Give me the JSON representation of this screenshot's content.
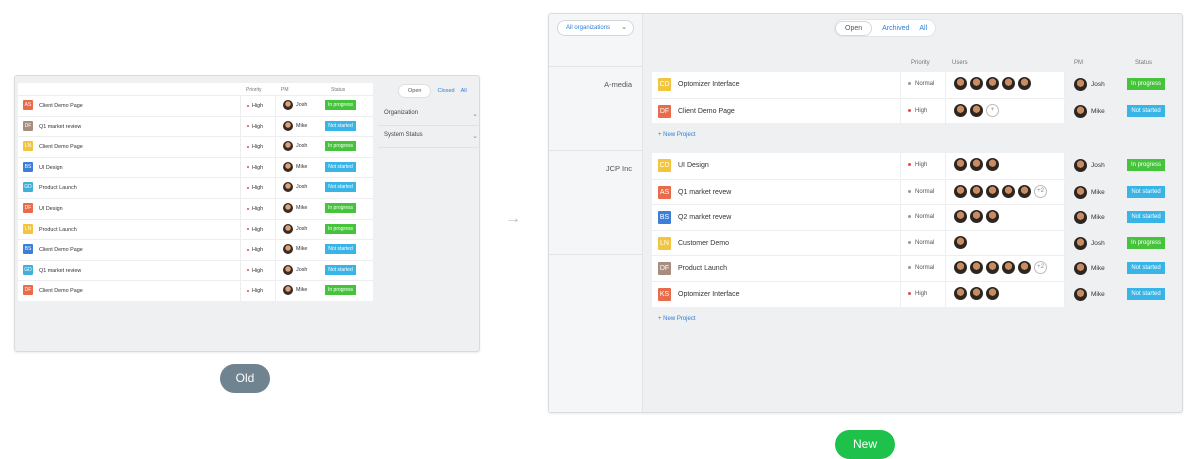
{
  "old": {
    "columns": {
      "priority": "Priority",
      "pm": "PM",
      "status": "Status"
    },
    "rows": [
      {
        "icon": "AS",
        "color": "#e96b4a",
        "name": "Client Demo Page",
        "priority": "High",
        "pm": "Josh",
        "status": "In progress",
        "status_color": "#45c33a"
      },
      {
        "icon": "DF",
        "color": "#a78d7f",
        "name": "Q1 market review",
        "priority": "High",
        "pm": "Mike",
        "status": "Not started",
        "status_color": "#39b4e6"
      },
      {
        "icon": "LN",
        "color": "#f3c43d",
        "name": "Client Demo Page",
        "priority": "High",
        "pm": "Josh",
        "status": "In progress",
        "status_color": "#45c33a"
      },
      {
        "icon": "BS",
        "color": "#3d7fd8",
        "name": "UI Design",
        "priority": "High",
        "pm": "Mike",
        "status": "Not started",
        "status_color": "#39b4e6"
      },
      {
        "icon": "GD",
        "color": "#3fb1d6",
        "name": "Product Launch",
        "priority": "High",
        "pm": "Josh",
        "status": "Not started",
        "status_color": "#39b4e6"
      },
      {
        "icon": "DF",
        "color": "#e96b4a",
        "name": "UI Design",
        "priority": "High",
        "pm": "Mike",
        "status": "In progress",
        "status_color": "#45c33a"
      },
      {
        "icon": "LN",
        "color": "#f3c43d",
        "name": "Product Launch",
        "priority": "High",
        "pm": "Josh",
        "status": "In progress",
        "status_color": "#45c33a"
      },
      {
        "icon": "BS",
        "color": "#3d7fd8",
        "name": "Client Demo Page",
        "priority": "High",
        "pm": "Mike",
        "status": "Not started",
        "status_color": "#39b4e6"
      },
      {
        "icon": "GD",
        "color": "#3fb1d6",
        "name": "Q1 market review",
        "priority": "High",
        "pm": "Josh",
        "status": "Not started",
        "status_color": "#39b4e6"
      },
      {
        "icon": "DF",
        "color": "#e96b4a",
        "name": "Client Demo Page",
        "priority": "High",
        "pm": "Mike",
        "status": "In progress",
        "status_color": "#45c33a"
      }
    ],
    "tabs": {
      "open": "Open",
      "closed": "Closed",
      "all": "All"
    },
    "filters": {
      "organization": "Organization",
      "system_status": "System Status"
    },
    "badge": "Old"
  },
  "new": {
    "org_select": "All organizations",
    "tabs": {
      "open": "Open",
      "archived": "Archived",
      "all": "All"
    },
    "columns": {
      "priority": "Priority",
      "users": "Users",
      "pm": "PM",
      "status": "Status"
    },
    "groups": [
      {
        "name": "A-media",
        "rows": [
          {
            "icon": "CD",
            "color": "#f3c43d",
            "name": "Optomizer Interface",
            "priority": "Normal",
            "users": 5,
            "pm": "Josh",
            "status": "In progress",
            "status_color": "#45c33a"
          },
          {
            "icon": "DF",
            "color": "#e96b4a",
            "name": "Client Demo Page",
            "priority": "High",
            "users": 2,
            "plus": "+",
            "pm": "Mike",
            "status": "Not started",
            "status_color": "#39b4e6"
          }
        ]
      },
      {
        "name": "JCP Inc",
        "rows": [
          {
            "icon": "CD",
            "color": "#f3c43d",
            "name": "UI Design",
            "priority": "High",
            "users": 3,
            "pm": "Josh",
            "status": "In progress",
            "status_color": "#45c33a"
          },
          {
            "icon": "AS",
            "color": "#e96b4a",
            "name": "Q1 market revew",
            "priority": "Normal",
            "users": 5,
            "plus": "+2",
            "pm": "Mike",
            "status": "Not started",
            "status_color": "#39b4e6"
          },
          {
            "icon": "BS",
            "color": "#3d7fd8",
            "name": "Q2 market revew",
            "priority": "Normal",
            "users": 3,
            "pm": "Mike",
            "status": "Not started",
            "status_color": "#39b4e6"
          },
          {
            "icon": "LN",
            "color": "#f3c43d",
            "name": "Customer Demo",
            "priority": "Normal",
            "users": 1,
            "pm": "Josh",
            "status": "In progress",
            "status_color": "#45c33a"
          },
          {
            "icon": "DF",
            "color": "#a78d7f",
            "name": "Product Launch",
            "priority": "Normal",
            "users": 5,
            "plus": "+2",
            "pm": "Mike",
            "status": "Not started",
            "status_color": "#39b4e6"
          },
          {
            "icon": "KS",
            "color": "#e96b4a",
            "name": "Optomizer Interface",
            "priority": "High",
            "users": 3,
            "pm": "Mike",
            "status": "Not started",
            "status_color": "#39b4e6"
          }
        ]
      }
    ],
    "new_project": "+ New Project",
    "badge": "New"
  },
  "colors": {
    "high": "#e04b4b",
    "normal": "#999999",
    "link": "#2d7fd3"
  }
}
